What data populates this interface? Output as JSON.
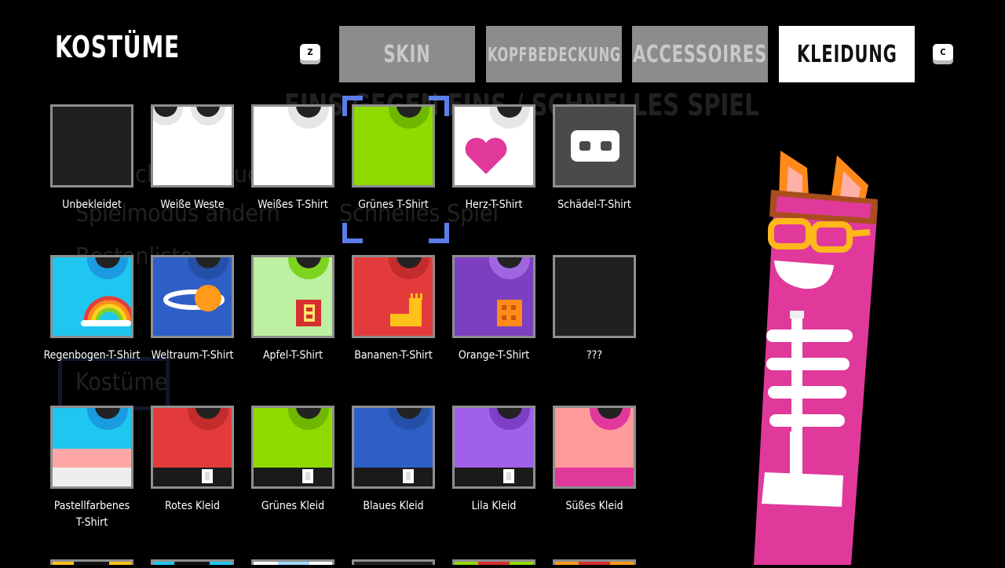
{
  "header": {
    "title": "KOSTÜME",
    "key_left": "Z",
    "key_right": "C"
  },
  "tabs": [
    {
      "label": "SKIN",
      "active": false
    },
    {
      "label": "KOPFBEDECKUNG",
      "active": false
    },
    {
      "label": "ACCESSOIRES",
      "active": false
    },
    {
      "label": "KLEIDUNG",
      "active": true
    }
  ],
  "background_menu": {
    "heading": "EINS GEGEN EINS  /  SCHNELLES SPIEL",
    "items": [
      "Spielmodus ändern",
      "Bestenliste",
      "Kostüme"
    ],
    "fragment_1": "Schnelles Spiel",
    "fragment_2": "ch",
    "fragment_3": "uc"
  },
  "items": [
    {
      "label": "Unbekleidet",
      "icon": "empty-shirt-icon"
    },
    {
      "label": "Weiße Weste",
      "icon": "white-vest-icon"
    },
    {
      "label": "Weißes T-Shirt",
      "icon": "white-tshirt-icon"
    },
    {
      "label": "Grünes T-Shirt",
      "icon": "green-tshirt-icon"
    },
    {
      "label": "Herz-T-Shirt",
      "icon": "heart-tshirt-icon"
    },
    {
      "label": "Schädel-T-Shirt",
      "icon": "skull-tshirt-icon"
    },
    {
      "label": "Regenbogen-T-Shirt",
      "icon": "rainbow-tshirt-icon"
    },
    {
      "label": "Weltraum-T-Shirt",
      "icon": "space-tshirt-icon"
    },
    {
      "label": "Apfel-T-Shirt",
      "icon": "apple-tshirt-icon"
    },
    {
      "label": "Bananen-T-Shirt",
      "icon": "banana-tshirt-icon"
    },
    {
      "label": "Orange-T-Shirt",
      "icon": "orange-tshirt-icon"
    },
    {
      "label": "???",
      "icon": "locked-item-icon"
    },
    {
      "label": "Pastellfarbenes T-Shirt",
      "icon": "pastel-tshirt-icon"
    },
    {
      "label": "Rotes Kleid",
      "icon": "red-dress-icon"
    },
    {
      "label": "Grünes Kleid",
      "icon": "green-dress-icon"
    },
    {
      "label": "Blaues Kleid",
      "icon": "blue-dress-icon"
    },
    {
      "label": "Lila Kleid",
      "icon": "purple-dress-icon"
    },
    {
      "label": "Süßes Kleid",
      "icon": "sweet-dress-icon"
    }
  ],
  "selected_item": "Grünes T-Shirt",
  "colors": {
    "tab_inactive": "#8c8c8c",
    "tab_active": "#ffffff",
    "selection": "#5b7de8",
    "character_body": "#e0399b"
  }
}
